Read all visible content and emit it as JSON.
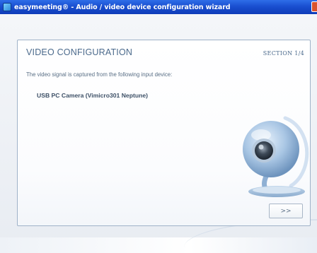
{
  "window": {
    "title": "easymeeting® - Audio / video device configuration wizard"
  },
  "panel": {
    "title": "VIDEO CONFIGURATION",
    "section": "SECTION 1/4",
    "intro": "The video signal is captured from the following input device:",
    "device": "USB PC Camera (Vimicro301 Neptune)"
  },
  "buttons": {
    "next_label": ">>"
  },
  "colors": {
    "titlebar": "#1a4fd0",
    "panel_border": "#9fb2c8",
    "heading_text": "#4b6a8c"
  }
}
